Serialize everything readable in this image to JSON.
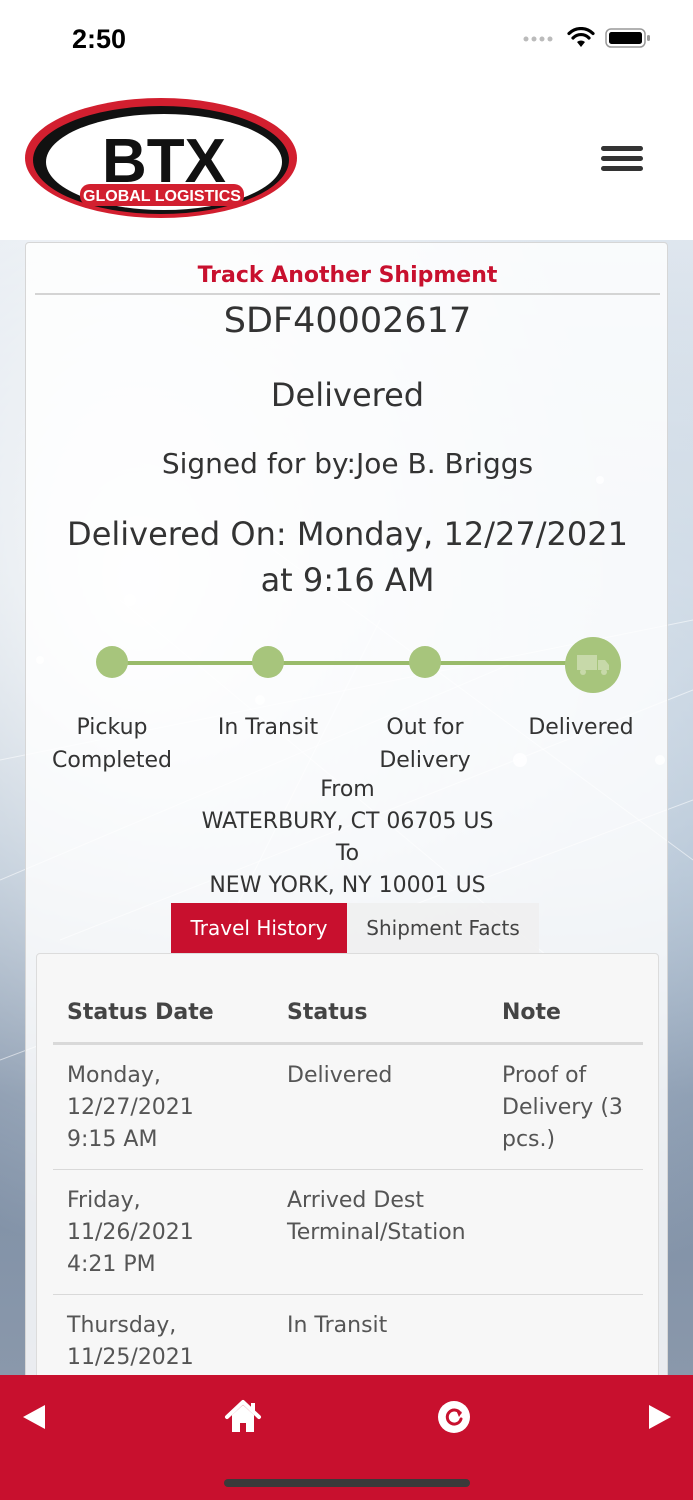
{
  "status_bar": {
    "time": "2:50"
  },
  "header": {
    "logo": {
      "brand": "BTX",
      "tagline": "GLOBAL LOGISTICS"
    },
    "menu_icon": "hamburger-menu-icon"
  },
  "shipment": {
    "track_another_label": "Track Another Shipment",
    "tracking_number": "SDF40002617",
    "status": "Delivered",
    "signed_for": "Signed for by:Joe B. Briggs",
    "delivered_on_line1": "Delivered On: Monday, 12/27/2021",
    "delivered_on_line2": "at 9:16 AM"
  },
  "progress": {
    "steps": [
      {
        "line1": "Pickup",
        "line2": "Completed"
      },
      {
        "line1": "In Transit",
        "line2": ""
      },
      {
        "line1": "Out for",
        "line2": "Delivery"
      },
      {
        "line1": "Delivered",
        "line2": ""
      }
    ],
    "current_step": 4,
    "current_icon": "truck-icon"
  },
  "route": {
    "from_label": "From",
    "from": "WATERBURY, CT 06705 US",
    "to_label": "To",
    "to": "NEW YORK, NY 10001 US"
  },
  "tabs": [
    {
      "label": "Travel History",
      "active": true
    },
    {
      "label": "Shipment Facts",
      "active": false
    }
  ],
  "history": {
    "headers": [
      "Status Date",
      "Status",
      "Note"
    ],
    "rows": [
      {
        "date": [
          "Monday,",
          "12/27/2021",
          "9:15 AM"
        ],
        "status": [
          "Delivered"
        ],
        "note": [
          "Proof of",
          "Delivery (3",
          "pcs.)"
        ]
      },
      {
        "date": [
          "Friday,",
          "11/26/2021",
          "4:21 PM"
        ],
        "status": [
          "Arrived Dest",
          "Terminal/Station"
        ],
        "note": []
      },
      {
        "date": [
          "Thursday,",
          "11/25/2021"
        ],
        "status": [
          "In Transit"
        ],
        "note": []
      }
    ]
  },
  "bottom_nav": {
    "back_icon": "back-arrow-icon",
    "home_icon": "home-icon",
    "refresh_icon": "refresh-icon",
    "forward_icon": "forward-arrow-icon"
  },
  "colors": {
    "brand_red": "#c8102e",
    "progress_green": "#a7c57c"
  }
}
